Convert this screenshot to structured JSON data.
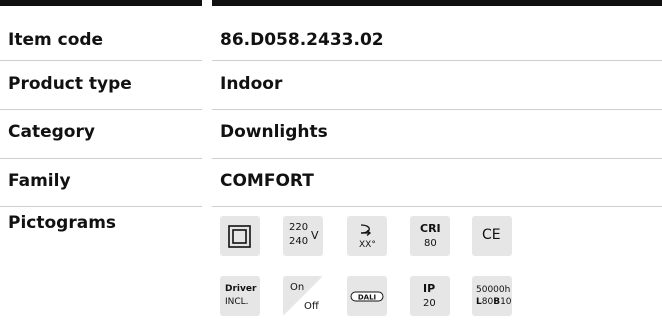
{
  "specs": [
    {
      "label": "Item code",
      "value": "86.D058.2433.02"
    },
    {
      "label": "Product type",
      "value": "Indoor"
    },
    {
      "label": "Category",
      "value": "Downlights"
    },
    {
      "label": "Family",
      "value": "COMFORT"
    }
  ],
  "pictograms_label": "Pictograms",
  "pictograms": {
    "class2": {
      "icon": "double-square-class-ii-icon"
    },
    "voltage": {
      "top": "220",
      "bottom": "240",
      "unit": "V"
    },
    "beam": {
      "icon": "beam-angle-icon",
      "text": "XX°"
    },
    "cri": {
      "label": "CRI",
      "value": "80"
    },
    "ce": {
      "text": "CE"
    },
    "driver": {
      "line1": "Driver",
      "line2": "INCL."
    },
    "onoff": {
      "on": "On",
      "off": "Off"
    },
    "dali": {
      "text": "DALI"
    },
    "ip": {
      "label": "IP",
      "value": "20"
    },
    "lifetime": {
      "hours": "50000h",
      "l": "L",
      "l_val": "80",
      "b": "B",
      "b_val": "10"
    }
  }
}
